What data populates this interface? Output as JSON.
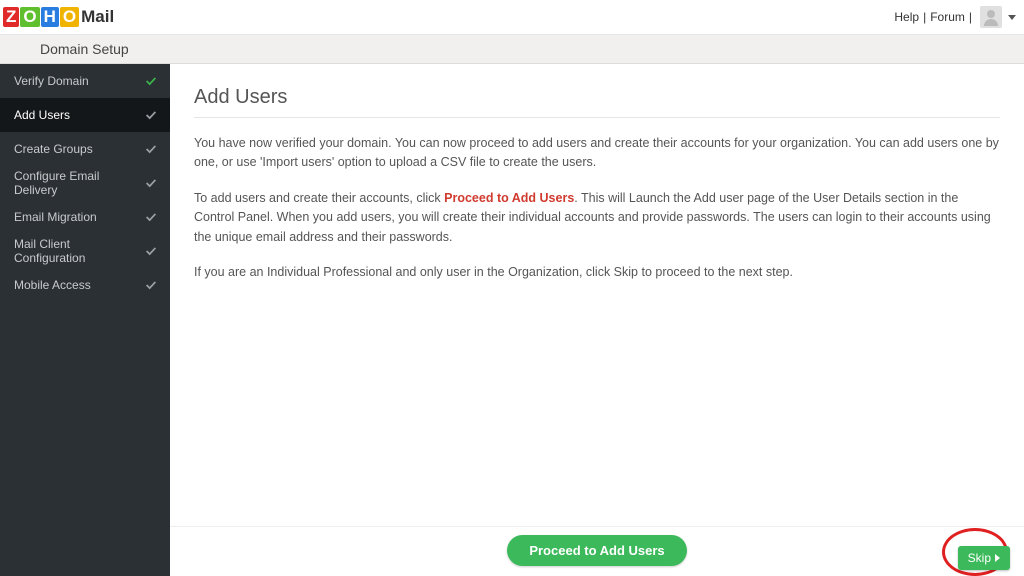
{
  "top": {
    "logo_brand": "Mail",
    "help": "Help",
    "forum": "Forum"
  },
  "subheader": {
    "title": "Domain Setup"
  },
  "sidebar": {
    "items": [
      {
        "label": "Verify Domain",
        "done": "green"
      },
      {
        "label": "Add Users",
        "done": "grey"
      },
      {
        "label": "Create Groups",
        "done": "grey"
      },
      {
        "label": "Configure Email Delivery",
        "done": "grey"
      },
      {
        "label": "Email Migration",
        "done": "grey"
      },
      {
        "label": "Mail Client Configuration",
        "done": "grey"
      },
      {
        "label": "Mobile Access",
        "done": "grey"
      }
    ]
  },
  "main": {
    "title": "Add Users",
    "para1": "You have now verified your domain. You can now proceed to add users and create their accounts for your organization. You can add users one by one, or use 'Import users' option to upload a CSV file to create the users.",
    "para2a": "To add users and create their accounts, click ",
    "para2_emph": "Proceed to Add Users",
    "para2b": ". This will Launch the Add user page of the User Details section in the Control Panel. When you add users, you will create their individual accounts and provide passwords. The users can login to their accounts using the unique email address and their passwords.",
    "para3": "If you are an Individual Professional and only user in the Organization, click Skip to proceed to the next step."
  },
  "buttons": {
    "primary": "Proceed to Add Users",
    "skip": "Skip"
  }
}
